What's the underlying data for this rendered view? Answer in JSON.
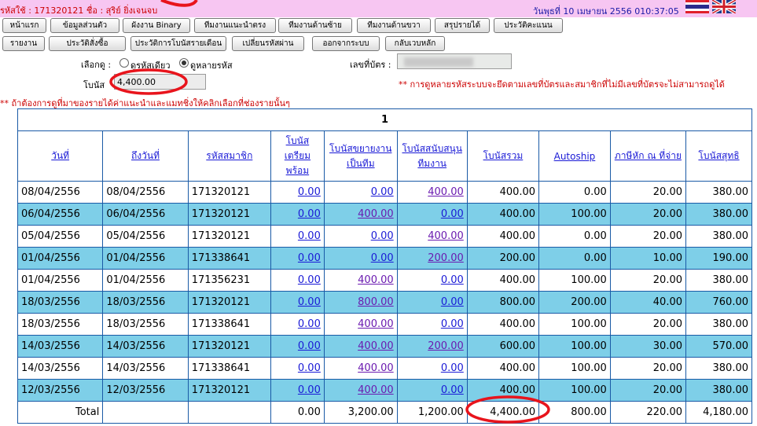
{
  "header": {
    "user_line": "รหัสใช้ : 171320121  ชื่อ : สุริย์ ยิ่งเจนจบ",
    "datetime": "วันพุธที่ 10 เมษายน 2556 010:37:05"
  },
  "nav_row1": [
    "หน้าแรก",
    "ข้อมูลส่วนตัว",
    "ผังงาน Binary",
    "ทีมงานแนะนำตรง",
    "ทีมงานด้านซ้าย",
    "ทีมงานด้านขวา",
    "สรุปรายได้",
    "ประวัติคะแนน"
  ],
  "nav_row2": [
    "รายงาน",
    "ประวัติสั่งซื้อ",
    "ประวัติการโบนัสรายเดือน",
    "เปลี่ยนรหัสผ่าน",
    "ออกจากระบบ",
    "กลับเวบหลัก"
  ],
  "filter": {
    "view_label": "เลือกดู :",
    "radio_single": "ดูรหัสเดียว",
    "radio_multi": "ดูหลายรหัส",
    "card_label": "เลขที่บัตร :",
    "bonus_label": "โบนัส",
    "bonus_value": "4,400.00",
    "note_right": "** การดูหลายรหัสระบบจะยึดตามเลขที่บัตรและสมาชิกที่ไม่มีเลขที่บัตรจะไม่สามารถดูได้",
    "note_left": "** ถ้าต้องการดูที่มาของรายได้ค่าแนะนำและแมทชิ่งให้คลิกเลือกที่ช่องรายนั้นๆ"
  },
  "table": {
    "page": "1",
    "headers": [
      "วันที่",
      "ถึงวันที่",
      "รหัสสมาชิก",
      "โบนัสเตรียมพร้อม",
      "โบนัสขยายงานเป็นทีม",
      "โบนัสสนับสนุนทีมงาน",
      "โบนัสรวม",
      "Autoship",
      "ภาษีหัก ณ ที่จ่าย",
      "โบนัสสุทธิ"
    ],
    "rows": [
      [
        "08/04/2556",
        "08/04/2556",
        "171320121",
        "0.00",
        "0.00",
        "400.00",
        "400.00",
        "0.00",
        "20.00",
        "380.00"
      ],
      [
        "06/04/2556",
        "06/04/2556",
        "171320121",
        "0.00",
        "400.00",
        "0.00",
        "400.00",
        "100.00",
        "20.00",
        "380.00"
      ],
      [
        "05/04/2556",
        "05/04/2556",
        "171320121",
        "0.00",
        "0.00",
        "400.00",
        "400.00",
        "0.00",
        "20.00",
        "380.00"
      ],
      [
        "01/04/2556",
        "01/04/2556",
        "171338641",
        "0.00",
        "0.00",
        "200.00",
        "200.00",
        "0.00",
        "10.00",
        "190.00"
      ],
      [
        "01/04/2556",
        "01/04/2556",
        "171356231",
        "0.00",
        "400.00",
        "0.00",
        "400.00",
        "100.00",
        "20.00",
        "380.00"
      ],
      [
        "18/03/2556",
        "18/03/2556",
        "171320121",
        "0.00",
        "800.00",
        "0.00",
        "800.00",
        "200.00",
        "40.00",
        "760.00"
      ],
      [
        "18/03/2556",
        "18/03/2556",
        "171338641",
        "0.00",
        "400.00",
        "0.00",
        "400.00",
        "100.00",
        "20.00",
        "380.00"
      ],
      [
        "14/03/2556",
        "14/03/2556",
        "171320121",
        "0.00",
        "400.00",
        "200.00",
        "600.00",
        "100.00",
        "30.00",
        "570.00"
      ],
      [
        "14/03/2556",
        "14/03/2556",
        "171338641",
        "0.00",
        "400.00",
        "0.00",
        "400.00",
        "100.00",
        "20.00",
        "380.00"
      ],
      [
        "12/03/2556",
        "12/03/2556",
        "171320121",
        "0.00",
        "400.00",
        "0.00",
        "400.00",
        "100.00",
        "20.00",
        "380.00"
      ]
    ],
    "total": [
      "Total",
      "",
      "",
      "0.00",
      "3,200.00",
      "1,200.00",
      "4,400.00",
      "800.00",
      "220.00",
      "4,180.00"
    ]
  },
  "colors": {
    "topbar": "#f7c6f2",
    "row_alt": "#7ecfe8",
    "note": "#cc0000",
    "annotation": "#e8141c"
  }
}
